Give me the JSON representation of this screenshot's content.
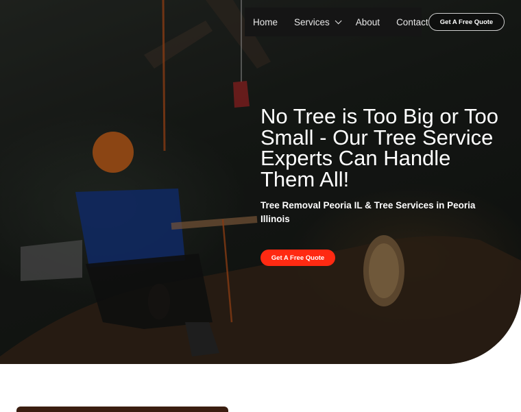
{
  "nav": {
    "items": [
      {
        "label": "Home"
      },
      {
        "label": "Services"
      },
      {
        "label": "About"
      },
      {
        "label": "Contact"
      }
    ],
    "cta_label": "Get A Free Quote"
  },
  "hero": {
    "headline": "No Tree is Too Big or Too Small - Our Tree Service Experts Can Handle Them All!",
    "subheadline": "Tree Removal Peoria IL & Tree Services in Peoria Illinois",
    "cta_label": "Get A Free Quote"
  },
  "colors": {
    "accent": "#ff2a12",
    "nav_background": "#151515",
    "hero_dark": "#1c201c"
  },
  "icons": {
    "services_dropdown": "chevron-down-icon"
  }
}
